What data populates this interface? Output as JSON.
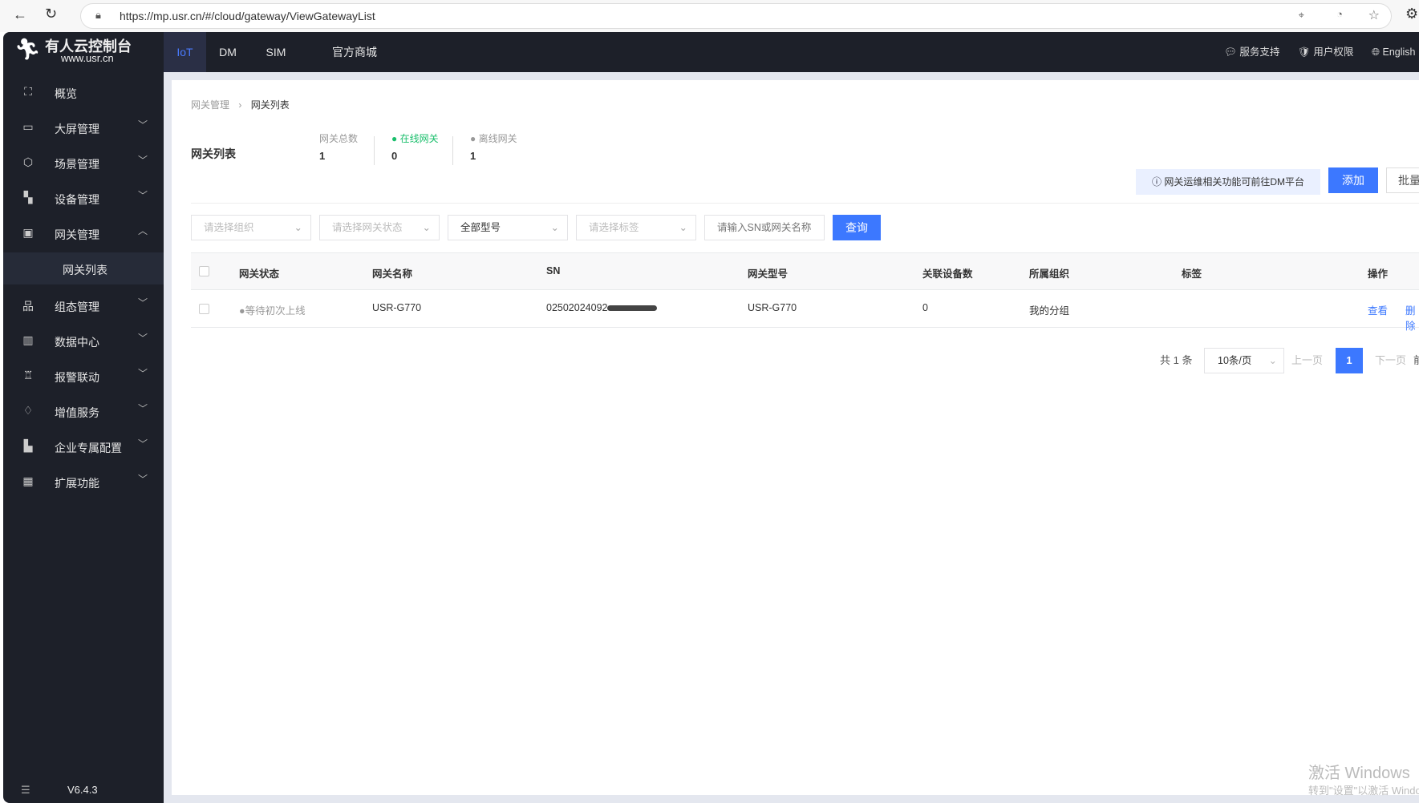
{
  "browser": {
    "url": "https://mp.usr.cn/#/cloud/gateway/ViewGatewayList"
  },
  "brand": {
    "name": "有人云控制台",
    "site": "www.usr.cn"
  },
  "topnav": {
    "tabs": [
      {
        "label": "IoT",
        "active": true
      },
      {
        "label": "DM"
      },
      {
        "label": "SIM"
      },
      {
        "label": "官方商城"
      }
    ],
    "right": [
      {
        "label": "服务支持",
        "icon": "chat-icon"
      },
      {
        "label": "用户权限",
        "icon": "shield-icon"
      },
      {
        "label": "English",
        "icon": "globe-icon"
      }
    ]
  },
  "sidebar": {
    "items": [
      {
        "label": "概览",
        "icon": "overview-icon"
      },
      {
        "label": "大屏管理",
        "icon": "monitor-icon"
      },
      {
        "label": "场景管理",
        "icon": "cube-icon"
      },
      {
        "label": "设备管理",
        "icon": "device-icon"
      },
      {
        "label": "网关管理",
        "icon": "gateway-icon",
        "expanded": true
      },
      {
        "label": "网关列表",
        "sub": true,
        "active": true
      },
      {
        "label": "组态管理",
        "icon": "topology-icon"
      },
      {
        "label": "数据中心",
        "icon": "bar-chart-icon"
      },
      {
        "label": "报警联动",
        "icon": "alarm-icon"
      },
      {
        "label": "增值服务",
        "icon": "diamond-icon"
      },
      {
        "label": "企业专属配置",
        "icon": "building-icon"
      },
      {
        "label": "扩展功能",
        "icon": "grid-icon"
      }
    ],
    "version": "V6.4.3"
  },
  "breadcrumb": [
    "网关管理",
    "网关列表"
  ],
  "page": {
    "title": "网关列表",
    "stats": [
      {
        "label": "网关总数",
        "value": "1"
      },
      {
        "label": "在线网关",
        "value": "0",
        "color": "#19be6b"
      },
      {
        "label": "离线网关",
        "value": "1",
        "color": "#999999"
      }
    ],
    "notice": "网关运维相关功能可前往DM平台",
    "add_label": "添加",
    "batch_label": "批量"
  },
  "filters": {
    "org": "请选择组织",
    "status": "请选择网关状态",
    "model": "全部型号",
    "tag": "请选择标签",
    "search_placeholder": "请输入SN或网关名称",
    "query_label": "查询"
  },
  "table": {
    "headers": [
      "网关状态",
      "网关名称",
      "SN",
      "网关型号",
      "关联设备数",
      "所属组织",
      "标签",
      "操作"
    ],
    "rows": [
      {
        "status": "等待初次上线",
        "name": "USR-G770",
        "sn": "02502024092",
        "model": "USR-G770",
        "devices": "0",
        "org": "我的分组",
        "tag": "",
        "view": "查看",
        "delete": "删除"
      }
    ]
  },
  "pagination": {
    "total": "共 1 条",
    "page_size": "10条/页",
    "prev": "上一页",
    "current": "1",
    "next": "下一页",
    "jump": "前"
  },
  "watermark": {
    "line1": "激活 Windows",
    "line2": "转到\"设置\"以激活 Windows。"
  },
  "colors": {
    "accent": "#3c78ff",
    "sidebar": "#1d2029"
  }
}
